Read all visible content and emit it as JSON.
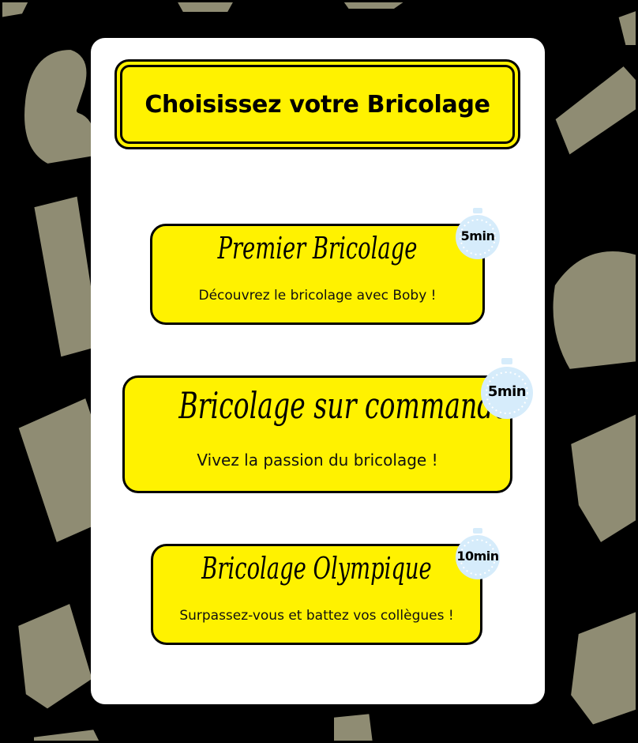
{
  "title": "Choisissez votre Bricolage",
  "cards": [
    {
      "title": "Premier Bricolage",
      "description": "Découvrez le bricolage avec Boby !",
      "duration": "5min"
    },
    {
      "title": "Bricolage sur commande",
      "description": "Vivez la passion du bricolage !",
      "duration": "5min"
    },
    {
      "title": "Bricolage Olympique",
      "description": "Surpassez-vous et battez vos collègues !",
      "duration": "10min"
    }
  ],
  "colors": {
    "accent": "#fff200",
    "background": "#000000",
    "tool_icons": "#8f8c73",
    "timer": "#d6ecfb"
  },
  "icons": [
    "flexed-arm-icon",
    "ruler-icon",
    "helmet-icon",
    "calculator-icon",
    "brick-icon",
    "glove-icon",
    "drill-icon",
    "stopwatch-icon"
  ]
}
